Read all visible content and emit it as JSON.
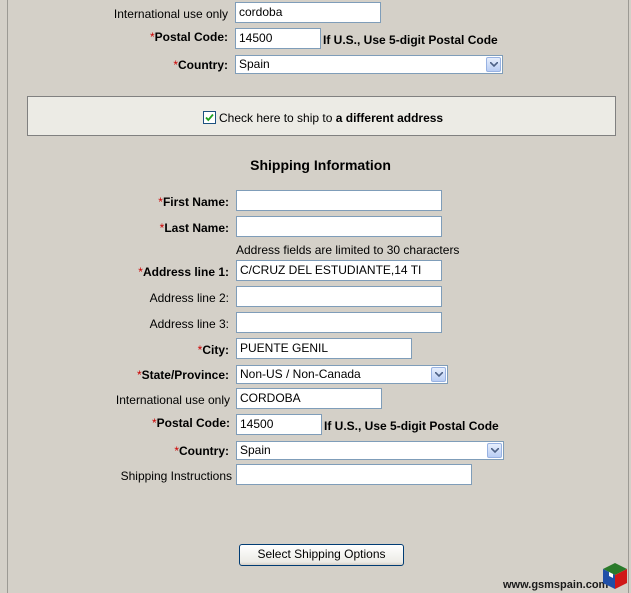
{
  "billing": {
    "intl_label": "International use only",
    "intl_value": "cordoba",
    "postal_label": "Postal Code:",
    "postal_value": "14500",
    "postal_hint": "If U.S., Use 5-digit Postal Code",
    "country_label": "Country:",
    "country_value": "Spain"
  },
  "ship_toggle": {
    "label_prefix": "Check here to ship to ",
    "label_bold": "a different address",
    "checked": true
  },
  "shipping": {
    "heading": "Shipping Information",
    "required_mark": "*",
    "first_name_label": "First Name:",
    "first_name_value": "",
    "last_name_label": "Last Name:",
    "last_name_value": "",
    "address_note": "Address fields are limited to 30 characters",
    "address1_label": "Address line 1:",
    "address1_value": "C/CRUZ DEL ESTUDIANTE,14 TI",
    "address2_label": "Address line 2:",
    "address2_value": "",
    "address3_label": "Address line 3:",
    "address3_value": "",
    "city_label": "City:",
    "city_value": "PUENTE GENIL",
    "state_label": "State/Province:",
    "state_value": "Non-US / Non-Canada",
    "intl_label": "International use only",
    "intl_value": "CORDOBA",
    "postal_label": "Postal Code:",
    "postal_value": "14500",
    "postal_hint": "If U.S., Use 5-digit Postal Code",
    "country_label": "Country:",
    "country_value": "Spain",
    "instructions_label": "Shipping Instructions",
    "instructions_value": ""
  },
  "actions": {
    "select_shipping_label": "Select Shipping Options"
  },
  "watermark": {
    "text": "www.gsmspain.com",
    "logo_colors": [
      "#2a7a2a",
      "#1f4fa8",
      "#d01818"
    ]
  },
  "colors": {
    "page_bg": "#d4d0c8",
    "required": "#cc0000",
    "input_border": "#7f9db9"
  }
}
